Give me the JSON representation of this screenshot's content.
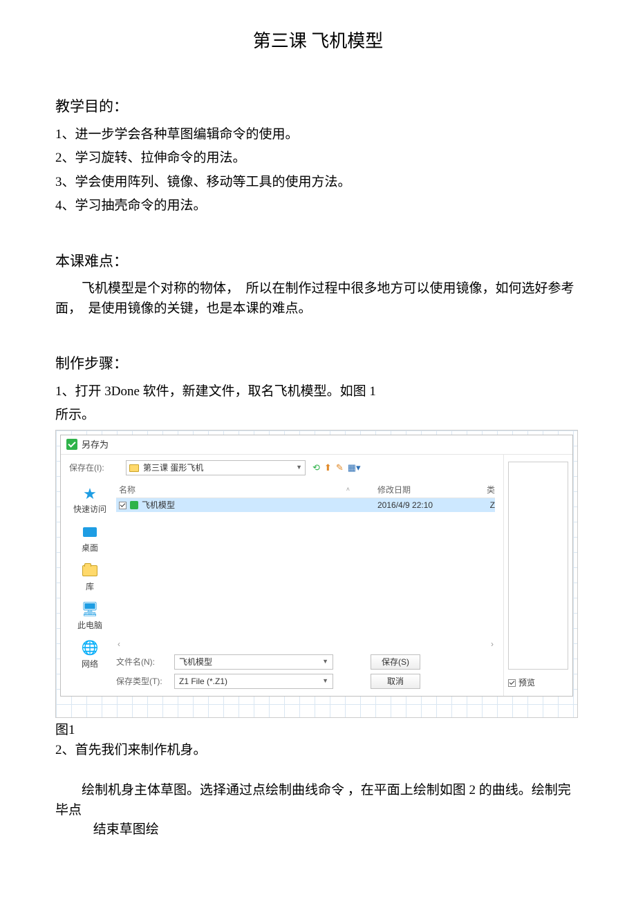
{
  "doc": {
    "title": "第三课 飞机模型",
    "goals_head": "教学目的：",
    "goals": [
      "1、进一步学会各种草图编辑命令的使用。",
      "2、学习旋转、拉伸命令的用法。",
      "3、学会使用阵列、镜像、移动等工具的使用方法。",
      "4、学习抽壳命令的用法。"
    ],
    "difficulty_head": "本课难点：",
    "difficulty_body": "飞机模型是个对称的物体，　所以在制作过程中很多地方可以使用镜像，如何选好参考面，　是使用镜像的关键，也是本课的难点。",
    "steps_head": "制作步骤：",
    "step1_a": "1、打开 3Done 软件，新建文件，取名飞机模型。如图 1",
    "step1_b": "所示。",
    "fig1_label": "图1",
    "step2": "2、首先我们来制作机身。",
    "step2_body_a": "绘制机身主体草图。选择通过点绘制曲线命令 ，在平面上绘制如图 2 的曲线。绘制完毕点",
    "step2_body_b": "结束草图绘"
  },
  "dialog": {
    "title": "另存为",
    "save_in_label": "保存在(I):",
    "save_in_value": "第三课 蛋形飞机",
    "places": {
      "quick": "快速访问",
      "desktop": "桌面",
      "lib": "库",
      "pc": "此电脑",
      "net": "网络"
    },
    "headers": {
      "name": "名称",
      "date": "修改日期",
      "type_abbrev": "类"
    },
    "file": {
      "name": "飞机模型",
      "date": "2016/4/9 22:10",
      "type_abbrev": "Z"
    },
    "filename_label": "文件名(N):",
    "filename_value": "飞机模型",
    "filetype_label": "保存类型(T):",
    "filetype_value": "Z1 File (*.Z1)",
    "save_btn": "保存(S)",
    "cancel_btn": "取消",
    "preview_label": "预览"
  }
}
